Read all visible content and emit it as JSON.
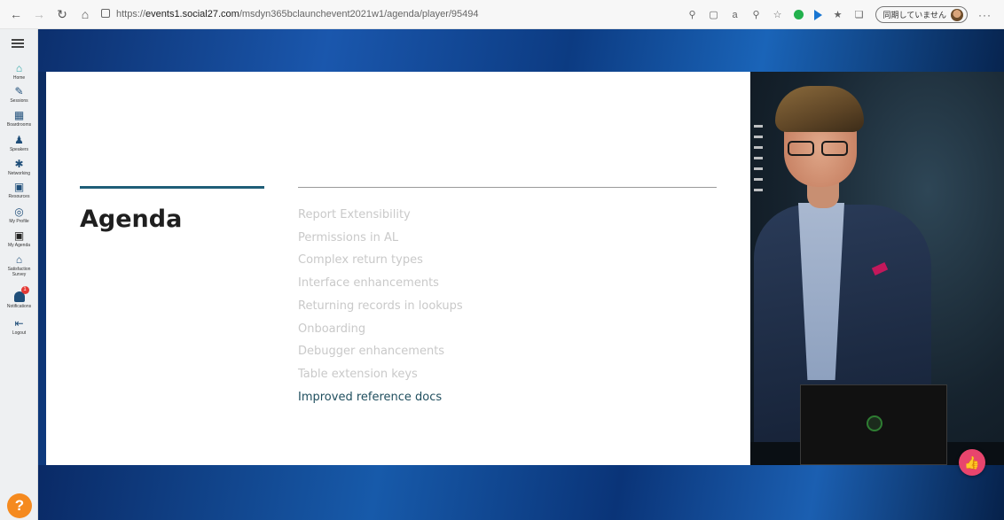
{
  "browser": {
    "url_prefix": "https://",
    "url_host": "events1.social27.com",
    "url_path": "/msdyn365bclaunchevent2021w1/agenda/player/95494",
    "sync_label": "同期していません",
    "more_label": "···"
  },
  "sidebar": {
    "items": [
      {
        "label": "Home",
        "icon": "home-icon"
      },
      {
        "label": "Sessions",
        "icon": "pen-icon"
      },
      {
        "label": "Boardrooms",
        "icon": "boardroom-icon"
      },
      {
        "label": "Speakers",
        "icon": "speaker-icon"
      },
      {
        "label": "Networking",
        "icon": "network-icon"
      },
      {
        "label": "Resources",
        "icon": "resources-icon"
      },
      {
        "label": "My Profile",
        "icon": "profile-icon"
      },
      {
        "label": "My Agenda",
        "icon": "calendar-icon"
      },
      {
        "label": "Satisfaction Survey",
        "icon": "survey-icon"
      },
      {
        "label": "Notifications",
        "icon": "bell-icon"
      },
      {
        "label": "Logout",
        "icon": "logout-icon"
      }
    ],
    "notification_count": "1",
    "help_label": "?"
  },
  "slide": {
    "title": "Agenda",
    "items": [
      "Report Extensibility",
      "Permissions in AL",
      "Complex return types",
      "Interface enhancements",
      "Returning records in lookups",
      "Onboarding",
      "Debugger enhancements",
      "Table extension keys",
      "Improved reference docs"
    ],
    "active_index": 8
  },
  "colors": {
    "accent": "#1f5e78",
    "active_item": "#1f4e5e",
    "inactive_item": "#c9c9c9",
    "like_button": "#e8456d",
    "help_button": "#f58a1f"
  }
}
